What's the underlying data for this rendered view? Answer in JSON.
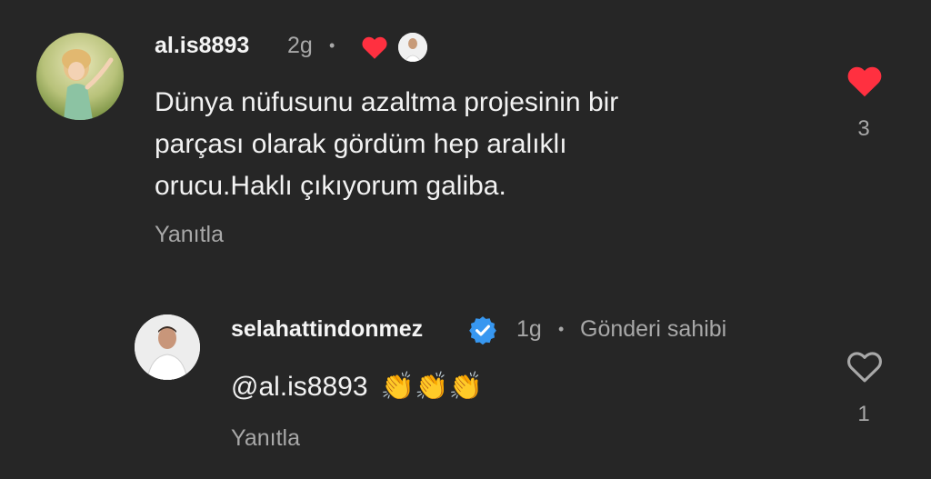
{
  "comment": {
    "username": "al.is8893",
    "time": "2g",
    "separator": "•",
    "text_lines": [
      "Dünya nüfusunu azaltma projesinin bir",
      "parçası olarak gördüm hep aralıklı",
      "orucu.Haklı çıkıyorum galiba."
    ],
    "reply_label": "Yanıtla",
    "like_count": "3",
    "liked": true,
    "creator_liked_icon": "heart-icon",
    "colors": {
      "like": "#ff3040"
    }
  },
  "reply": {
    "username": "selahattindonmez",
    "verified": true,
    "time": "1g",
    "separator": "•",
    "author_badge": "Gönderi sahibi",
    "mention": "@al.is8893",
    "emojis": "👏👏👏",
    "reply_label": "Yanıtla",
    "like_count": "1",
    "liked": false,
    "colors": {
      "verified": "#3797f0"
    }
  }
}
